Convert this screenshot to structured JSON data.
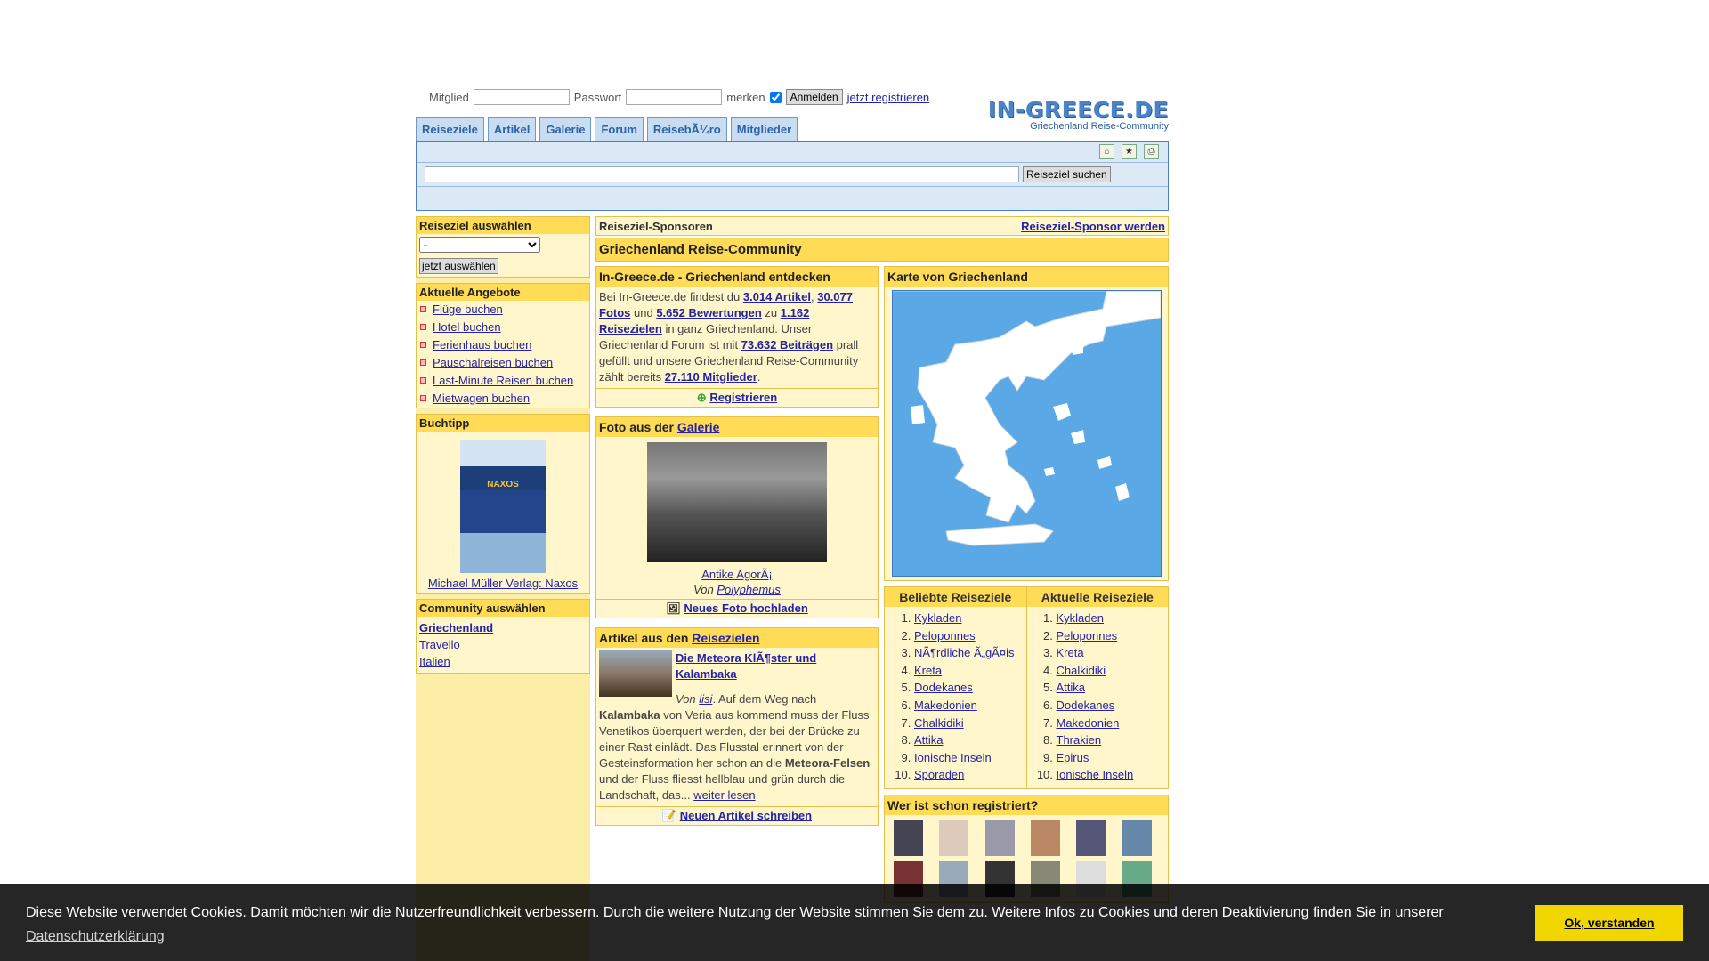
{
  "login": {
    "member_label": "Mitglied",
    "password_label": "Passwort",
    "remember_label": "merken",
    "login_button": "Anmelden",
    "register_link": "jetzt registrieren"
  },
  "logo": {
    "title": "IN-GREECE.DE",
    "subtitle": "Griechenland Reise-Community"
  },
  "tabs": [
    "Reiseziele",
    "Artikel",
    "Galerie",
    "Forum",
    "ReisebÃ¼ro",
    "Mitglieder"
  ],
  "search": {
    "button": "Reiseziel suchen",
    "value": ""
  },
  "left": {
    "select_title": "Reiseziel auswählen",
    "select_value": "-",
    "select_button": "jetzt auswählen",
    "offers_title": "Aktuelle Angebote",
    "offers": [
      "Flüge buchen",
      "Hotel buchen",
      "Ferienhaus buchen",
      "Pauschalreisen buchen",
      "Last-Minute Reisen buchen",
      "Mietwagen buchen"
    ],
    "book_title": "Buchtipp",
    "book_cover_text": "NAXOS",
    "book_link": "Michael Müller Verlag: Naxos",
    "community_title": "Community auswählen",
    "communities": [
      "Griechenland",
      "Travello",
      "Italien"
    ]
  },
  "sponsor": {
    "title": "Reiseziel-Sponsoren",
    "link": "Reiseziel-Sponsor werden"
  },
  "banner": "Griechenland Reise-Community",
  "intro": {
    "title": "In-Greece.de - Griechenland entdecken",
    "t1": "Bei In-Greece.de findest du ",
    "articles": "3.014 Artikel",
    "comma": ", ",
    "photos": "30.077 Fotos",
    "t2": " und ",
    "ratings": "5.652 Bewertungen",
    "t3": " zu ",
    "destinations": "1.162 Reisezielen",
    "t4": " in ganz Griechenland. Unser Griechenland Forum ist mit ",
    "posts": "73.632 Beiträgen",
    "t5": " prall gefüllt und unsere Griechenland Reise-Community zählt bereits ",
    "members": "27.110 Mitglieder",
    "t6": ".",
    "register": "Registrieren"
  },
  "photo": {
    "title_prefix": "Foto aus der ",
    "title_link": "Galerie",
    "caption": "Antike AgorÃ¡",
    "by": "Von ",
    "author": "Polyphemus",
    "upload": "Neues Foto hochladen"
  },
  "article": {
    "title_prefix": "Artikel aus den ",
    "title_link": "Reisezielen",
    "headline": "Die Meteora KlÃ¶ster und Kalambaka",
    "by": "Von ",
    "author": "lisi",
    "t1": ". Auf dem Weg nach ",
    "b1": "Kalambaka",
    "t2": " von Veria aus kommend muss der Fluss Venetikos überquert werden, der bei der Brücke zu einer Rast einlädt. Das Flusstal erinnert von der Gesteinsformation her schon an die ",
    "b2": "Meteora-Felsen",
    "t3": " und der Fluss fliesst hellblau und grün durch die Landschaft, das... ",
    "more": "weiter lesen",
    "write": "Neuen Artikel schreiben"
  },
  "map": {
    "title": "Karte von Griechenland"
  },
  "popular": {
    "title": "Beliebte Reiseziele",
    "items": [
      "Kykladen",
      "Peloponnes",
      "NÃ¶rdliche Ã„gÃ¤is",
      "Kreta",
      "Dodekanes",
      "Makedonien",
      "Chalkidiki",
      "Attika",
      "Ionische Inseln",
      "Sporaden"
    ]
  },
  "current": {
    "title": "Aktuelle Reiseziele",
    "items": [
      "Kykladen",
      "Peloponnes",
      "Kreta",
      "Chalkidiki",
      "Attika",
      "Dodekanes",
      "Makedonien",
      "Thrakien",
      "Epirus",
      "Ionische Inseln"
    ]
  },
  "registered": {
    "title": "Wer ist schon registriert?"
  },
  "cookie": {
    "message": "Diese Website verwendet Cookies. Damit möchten wir die Nutzerfreundlichkeit verbessern. Durch die weitere Nutzung der Website stimmen Sie dem zu. Weitere Infos zu Cookies und deren Deaktivierung finden Sie in unserer ",
    "link": "Datenschutzerklärung",
    "button": "Ok, verstanden"
  }
}
